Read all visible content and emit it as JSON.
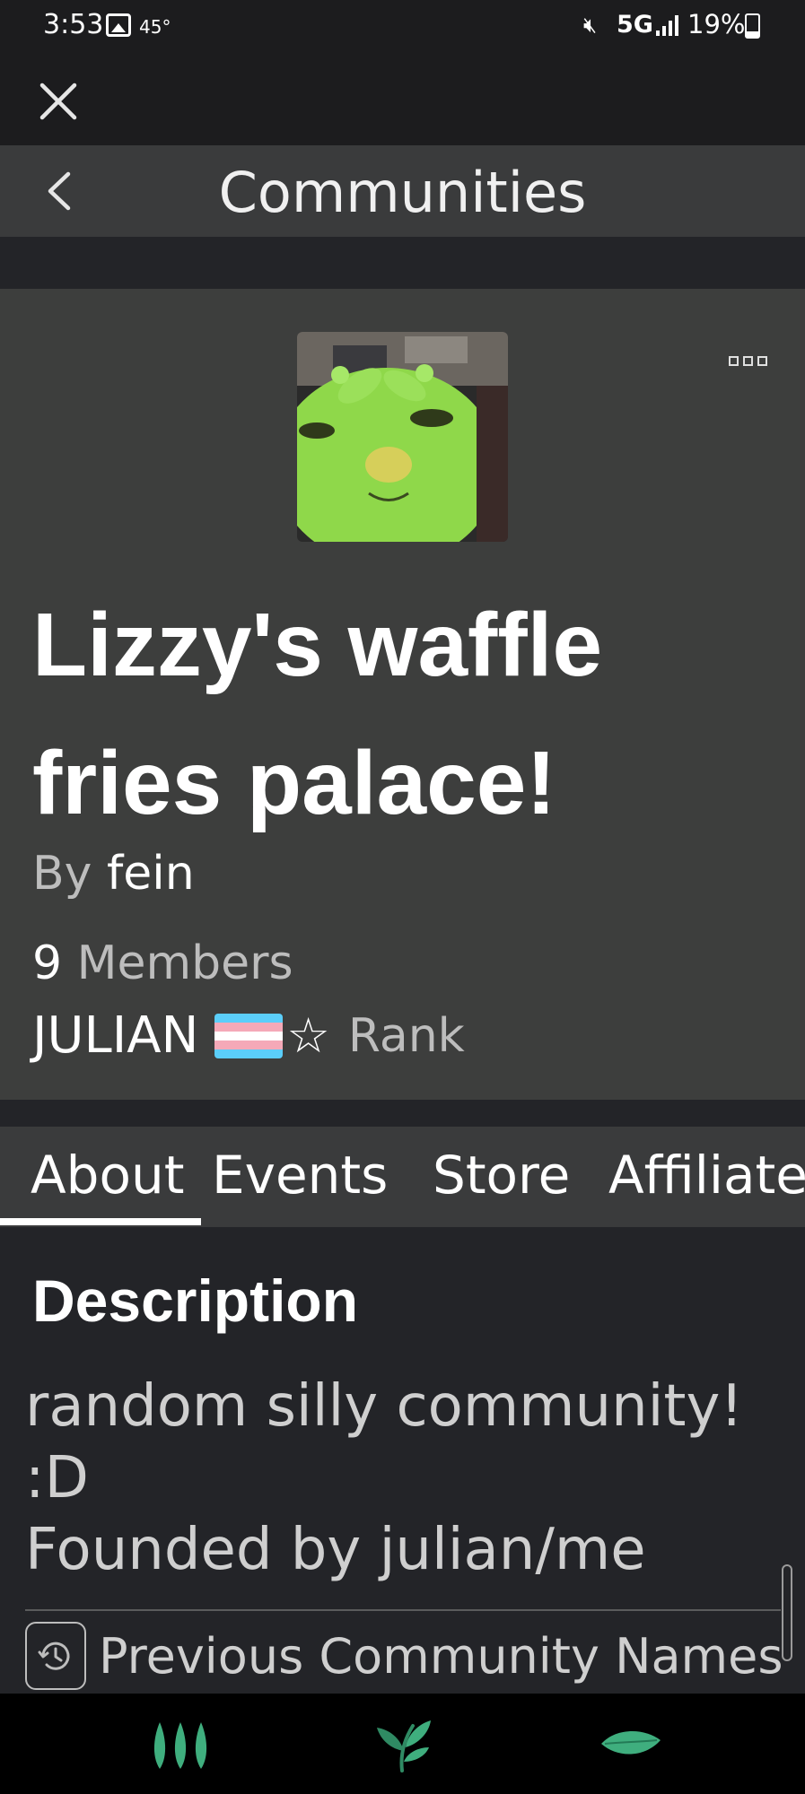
{
  "status_bar": {
    "time": "3:53",
    "temperature": "45°",
    "network": "5G",
    "battery": "19%"
  },
  "header": {
    "title": "Communities"
  },
  "community": {
    "name": "Lizzy's waffle fries palace!",
    "by_label": "By",
    "owner": "fein",
    "member_count": "9",
    "members_label": "Members",
    "rank_name": "JULIAN",
    "rank_star": "☆",
    "rank_label": "Rank"
  },
  "tabs": [
    {
      "label": "About",
      "selected": true
    },
    {
      "label": "Events",
      "selected": false
    },
    {
      "label": "Store",
      "selected": false
    },
    {
      "label": "Affiliates",
      "selected": false
    }
  ],
  "about": {
    "heading": "Description",
    "body": "random silly community!\n:D\nFounded by julian/me",
    "previous_names_label": "Previous Community Names"
  },
  "icons": {
    "close": "close-icon",
    "back": "back-chevron-icon",
    "more": "more-options-icon",
    "history": "history-icon",
    "nav_home": "three-leaves-icon",
    "nav_sprout": "sprout-icon",
    "nav_leaf": "leaf-icon"
  },
  "colors": {
    "accent_green": "#3fae7e",
    "trans_blue": "#5bcefa",
    "trans_pink": "#f5a9b8",
    "background": "#232428",
    "card": "#3d3e3d"
  }
}
